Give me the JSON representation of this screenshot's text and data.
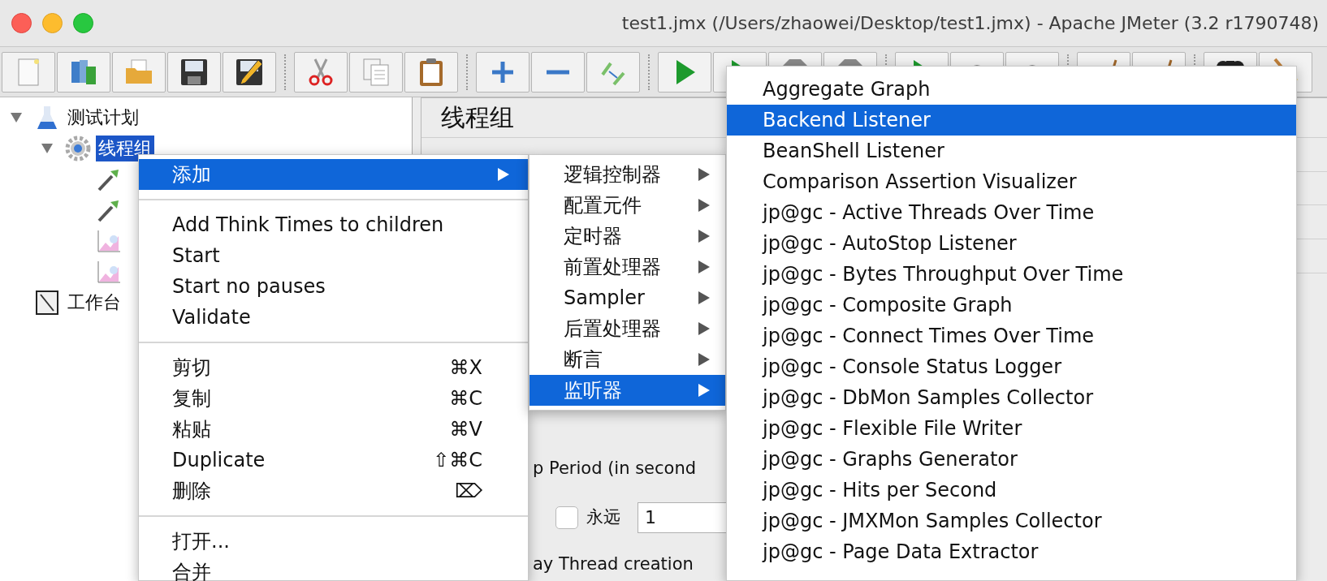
{
  "window": {
    "title": "test1.jmx (/Users/zhaowei/Desktop/test1.jmx) - Apache JMeter (3.2 r1790748)"
  },
  "toolbar": {
    "groups": [
      {
        "buttons": [
          {
            "kind": "new"
          },
          {
            "kind": "templates"
          },
          {
            "kind": "open"
          },
          {
            "kind": "save"
          },
          {
            "kind": "save-as"
          }
        ]
      },
      {
        "buttons": [
          {
            "kind": "cut"
          },
          {
            "kind": "copy"
          },
          {
            "kind": "paste"
          }
        ]
      },
      {
        "buttons": [
          {
            "kind": "expand"
          },
          {
            "kind": "collapse"
          },
          {
            "kind": "toggle"
          }
        ]
      },
      {
        "buttons": [
          {
            "kind": "start"
          },
          {
            "kind": "start"
          },
          {
            "kind": "stop"
          },
          {
            "kind": "stop"
          }
        ]
      },
      {
        "buttons": [
          {
            "kind": "start"
          },
          {
            "kind": "remote-stop"
          },
          {
            "kind": "remote-stop"
          }
        ]
      },
      {
        "buttons": [
          {
            "kind": "clear"
          },
          {
            "kind": "clear"
          }
        ]
      },
      {
        "buttons": [
          {
            "kind": "search"
          },
          {
            "kind": "reset-search"
          }
        ]
      }
    ]
  },
  "tree": {
    "items": [
      {
        "label": "测试计划",
        "kind": "plan",
        "selected": false,
        "expanded": true,
        "children": [
          {
            "label": "线程组",
            "kind": "thread-group",
            "selected": true,
            "expanded": true,
            "children": [
              {
                "kind": "sampler",
                "selected": false
              },
              {
                "kind": "sampler",
                "selected": false
              },
              {
                "kind": "listener",
                "selected": false
              },
              {
                "kind": "listener",
                "selected": false
              }
            ]
          }
        ]
      },
      {
        "label": "工作台",
        "kind": "workbench",
        "selected": false
      }
    ]
  },
  "panel": {
    "title": "线程组",
    "ramp_up_label": "p Period (in second",
    "forever": {
      "label": "永远",
      "checked": false
    },
    "loop_count": "1",
    "delay_label": "ay Thread creation"
  },
  "context_menu": {
    "items": [
      {
        "kind": "submenu",
        "label": "添加",
        "selected": true
      },
      {
        "kind": "separator"
      },
      {
        "kind": "item",
        "label": "Add Think Times to children"
      },
      {
        "kind": "item",
        "label": "Start"
      },
      {
        "kind": "item",
        "label": "Start no pauses"
      },
      {
        "kind": "item",
        "label": "Validate"
      },
      {
        "kind": "separator"
      },
      {
        "kind": "item",
        "label": "剪切",
        "shortcut": "⌘X"
      },
      {
        "kind": "item",
        "label": "复制",
        "shortcut": "⌘C"
      },
      {
        "kind": "item",
        "label": "粘贴",
        "shortcut": "⌘V"
      },
      {
        "kind": "item",
        "label": "Duplicate",
        "shortcut": "⇧⌘C"
      },
      {
        "kind": "item",
        "label": "删除",
        "shortcut": "⌦"
      },
      {
        "kind": "separator"
      },
      {
        "kind": "item",
        "label": "打开..."
      },
      {
        "kind": "item",
        "label": "合并"
      }
    ]
  },
  "add_submenu": {
    "items": [
      {
        "label": "逻辑控制器",
        "selected": false
      },
      {
        "label": "配置元件",
        "selected": false
      },
      {
        "label": "定时器",
        "selected": false
      },
      {
        "label": "前置处理器",
        "selected": false
      },
      {
        "label": "Sampler",
        "selected": false
      },
      {
        "label": "后置处理器",
        "selected": false
      },
      {
        "label": "断言",
        "selected": false
      },
      {
        "label": "监听器",
        "selected": true
      }
    ]
  },
  "listener_submenu": {
    "items": [
      {
        "label": "Aggregate Graph",
        "selected": false
      },
      {
        "label": "Backend Listener",
        "selected": true
      },
      {
        "label": "BeanShell Listener",
        "selected": false
      },
      {
        "label": "Comparison Assertion Visualizer",
        "selected": false
      },
      {
        "label": "jp@gc - Active Threads Over Time",
        "selected": false
      },
      {
        "label": "jp@gc - AutoStop Listener",
        "selected": false
      },
      {
        "label": "jp@gc - Bytes Throughput Over Time",
        "selected": false
      },
      {
        "label": "jp@gc - Composite Graph",
        "selected": false
      },
      {
        "label": "jp@gc - Connect Times Over Time",
        "selected": false
      },
      {
        "label": "jp@gc - Console Status Logger",
        "selected": false
      },
      {
        "label": "jp@gc - DbMon Samples Collector",
        "selected": false
      },
      {
        "label": "jp@gc - Flexible File Writer",
        "selected": false
      },
      {
        "label": "jp@gc - Graphs Generator",
        "selected": false
      },
      {
        "label": "jp@gc - Hits per Second",
        "selected": false
      },
      {
        "label": "jp@gc - JMXMon Samples Collector",
        "selected": false
      },
      {
        "label": "jp@gc - Page Data Extractor",
        "selected": false
      }
    ]
  }
}
